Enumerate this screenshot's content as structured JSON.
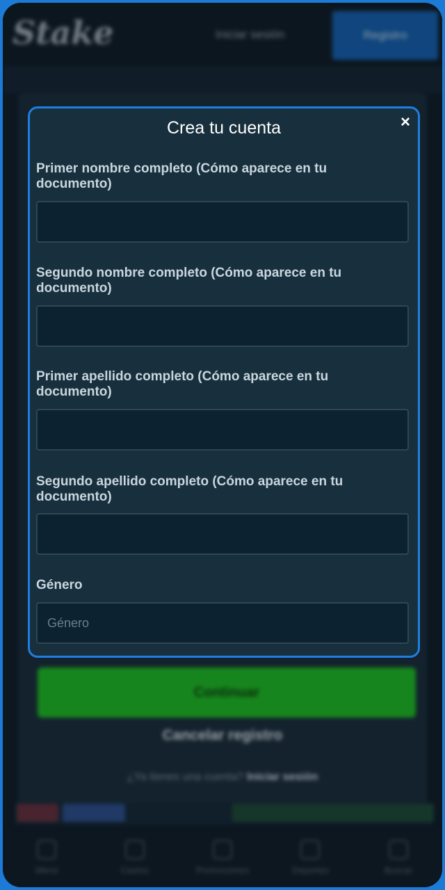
{
  "background": {
    "logo": "Stake",
    "login_link": "Iniciar sesión",
    "register_button": "Registro",
    "continue_button": "Continuar",
    "cancel_link": "Cancelar registro",
    "have_account_text": "¿Ya tienes una cuenta?",
    "have_account_link": "Iniciar sesión",
    "bottom_nav": [
      {
        "label": "Menú",
        "icon": "menu-icon"
      },
      {
        "label": "Casino",
        "icon": "casino-icon"
      },
      {
        "label": "Promociones",
        "icon": "promotions-icon"
      },
      {
        "label": "Deportes",
        "icon": "sports-icon"
      },
      {
        "label": "Buscar",
        "icon": "search-icon"
      }
    ]
  },
  "modal": {
    "title": "Crea tu cuenta",
    "close_icon": "×",
    "fields": [
      {
        "label": "Primer nombre completo (Cómo aparece en tu documento)",
        "value": "",
        "placeholder": ""
      },
      {
        "label": "Segundo nombre completo (Cómo aparece en tu documento)",
        "value": "",
        "placeholder": ""
      },
      {
        "label": "Primer apellido completo (Cómo aparece en tu documento)",
        "value": "",
        "placeholder": ""
      },
      {
        "label": "Segundo apellido completo (Cómo aparece en tu documento)",
        "value": "",
        "placeholder": ""
      },
      {
        "label": "Género",
        "value": "",
        "placeholder": "Género"
      }
    ]
  },
  "colors": {
    "accent": "#1e7fe0",
    "continue": "#1fc41f",
    "modal_bg": "#18303d"
  }
}
